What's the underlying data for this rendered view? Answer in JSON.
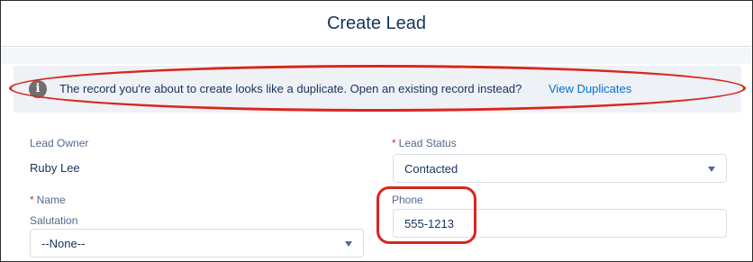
{
  "modal": {
    "title": "Create Lead"
  },
  "banner": {
    "icon": "info-icon",
    "message": "The record you're about to create looks like a duplicate. Open an existing record instead?",
    "link_label": "View Duplicates"
  },
  "form": {
    "lead_owner": {
      "label": "Lead Owner",
      "value": "Ruby Lee"
    },
    "lead_status": {
      "required_mark": "*",
      "label": "Lead Status",
      "value": "Contacted"
    },
    "name": {
      "required_mark": "*",
      "label": "Name"
    },
    "salutation": {
      "label": "Salutation",
      "value": "--None--"
    },
    "phone": {
      "label": "Phone",
      "value": "555-1213"
    }
  },
  "colors": {
    "annotation": "#d9261c",
    "link": "#0070d2",
    "required": "#c23934",
    "text": "#16325c",
    "label": "#54698d"
  }
}
